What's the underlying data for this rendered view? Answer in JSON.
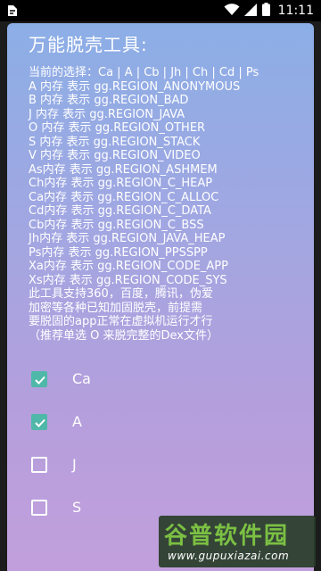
{
  "status_bar": {
    "time": "11:11",
    "icons": [
      "app-notification-icon",
      "wifi-icon",
      "signal-icon",
      "battery-icon"
    ]
  },
  "dialog": {
    "title": "万能脱壳工具:",
    "lines": [
      "当前的选择：Ca | A | Cb | Jh | Ch | Cd | Ps",
      "A 内存 表示 gg.REGION_ANONYMOUS",
      "B 内存 表示 gg.REGION_BAD",
      "J 内存 表示 gg.REGION_JAVA",
      "O 内存 表示 gg.REGION_OTHER",
      "S 内存 表示 gg.REGION_STACK",
      "V 内存 表示 gg.REGION_VIDEO",
      "As内存 表示 gg.REGION_ASHMEM",
      "Ch内存 表示 gg.REGION_C_HEAP",
      "Ca内存 表示 gg.REGION_C_ALLOC",
      "Cd内存 表示 gg.REGION_C_DATA",
      "Cb内存 表示 gg.REGION_C_BSS",
      "Jh内存 表示 gg.REGION_JAVA_HEAP",
      "Ps内存 表示 gg.REGION_PPSSPP",
      "Xa内存 表示 gg.REGION_CODE_APP",
      "Xs内存 表示 gg.REGION_CODE_SYS"
    ],
    "note": "此工具支持360，百度，腾讯，伪爱\n加密等各种已知加固脱壳，前提需\n要脱固的app正常在虚拟机运行才行\n（推荐单选 O 来脱完整的Dex文件）",
    "options": [
      {
        "label": "Ca",
        "checked": true
      },
      {
        "label": "A",
        "checked": true
      },
      {
        "label": "J",
        "checked": false
      },
      {
        "label": "S",
        "checked": false
      }
    ]
  },
  "watermark": {
    "title": "谷普软件园",
    "url": "www.gupuxiazai.com"
  },
  "colors": {
    "checkbox_checked": "#4fb8a8",
    "watermark_green": "#7bc043"
  }
}
